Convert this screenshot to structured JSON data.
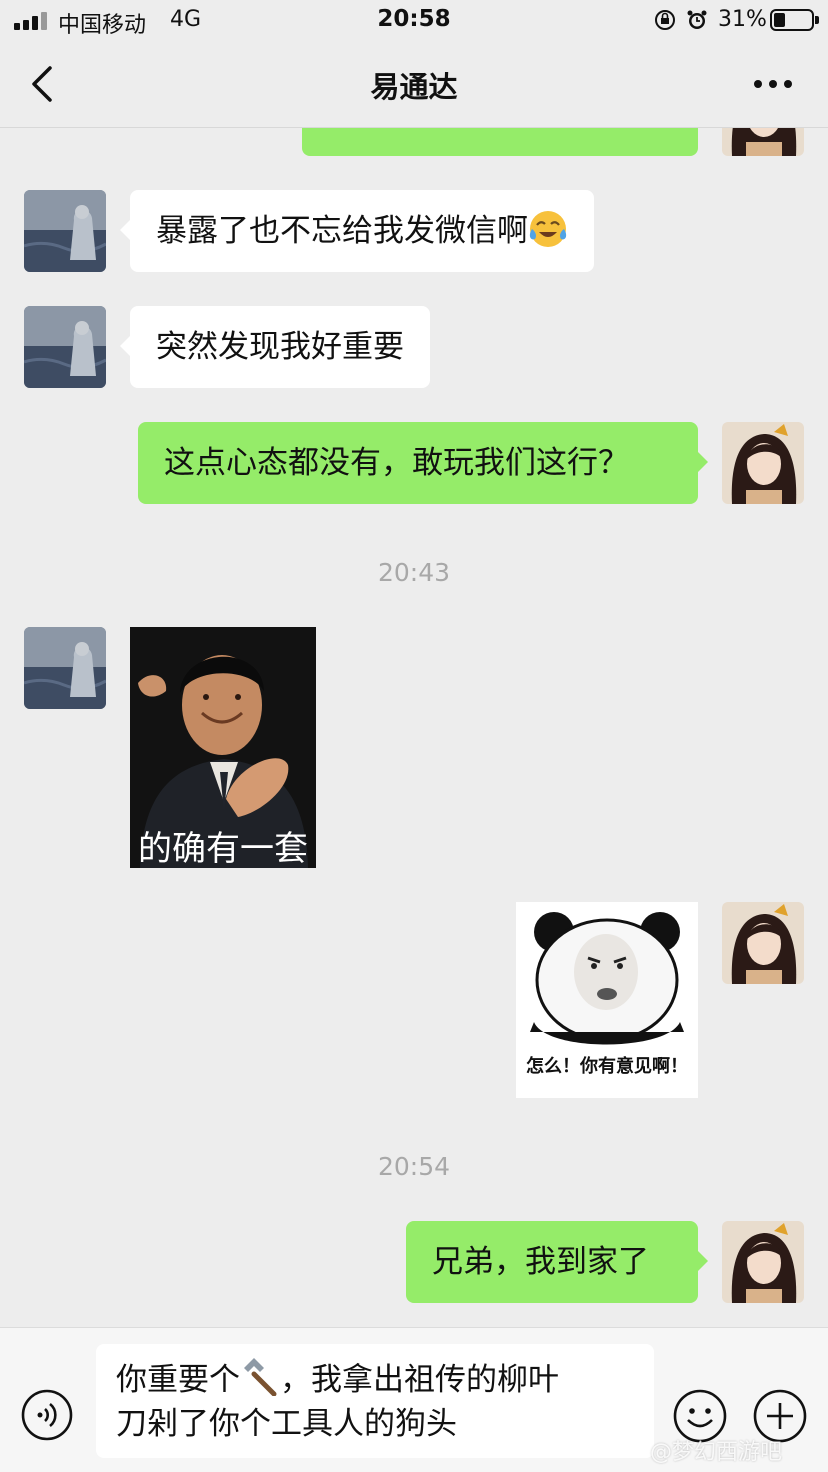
{
  "status_bar": {
    "carrier": "中国移动",
    "network": "4G",
    "time": "20:58",
    "battery_percent": "31%",
    "battery_level": 0.31,
    "icons": [
      "signal-icon",
      "orientation-lock-icon",
      "alarm-icon",
      "battery-icon"
    ]
  },
  "nav": {
    "title": "易通达",
    "back_icon": "chevron-left-icon",
    "more_icon": "more-dots-icon"
  },
  "messages": [
    {
      "direction": "in",
      "type": "text",
      "text": "暴露了也不忘给我发微信啊",
      "trailing_emoji": "crying-laughing-emoji"
    },
    {
      "direction": "in",
      "type": "text",
      "text": "突然发现我好重要"
    },
    {
      "direction": "out",
      "type": "text",
      "text": "这点心态都没有，敢玩我们这行？"
    },
    {
      "type": "timestamp",
      "text": "20:43"
    },
    {
      "direction": "in",
      "type": "sticker",
      "caption": "的确有一套"
    },
    {
      "direction": "out",
      "type": "sticker",
      "caption": "怎么！你有意见啊！"
    },
    {
      "type": "timestamp",
      "text": "20:54"
    },
    {
      "direction": "out",
      "type": "text",
      "text": "兄弟，我到家了"
    }
  ],
  "input": {
    "line1_a": "你重要个",
    "line1_b": "，我拿出祖传的柳叶",
    "line2": "刀剁了你个工具人的狗头",
    "inline_icon": "hammer-emoji"
  },
  "watermark": "@梦幻西游吧",
  "colors": {
    "background": "#ededed",
    "outgoing_bubble": "#95ec69",
    "incoming_bubble": "#ffffff",
    "timestamp": "#a8a8a8"
  }
}
